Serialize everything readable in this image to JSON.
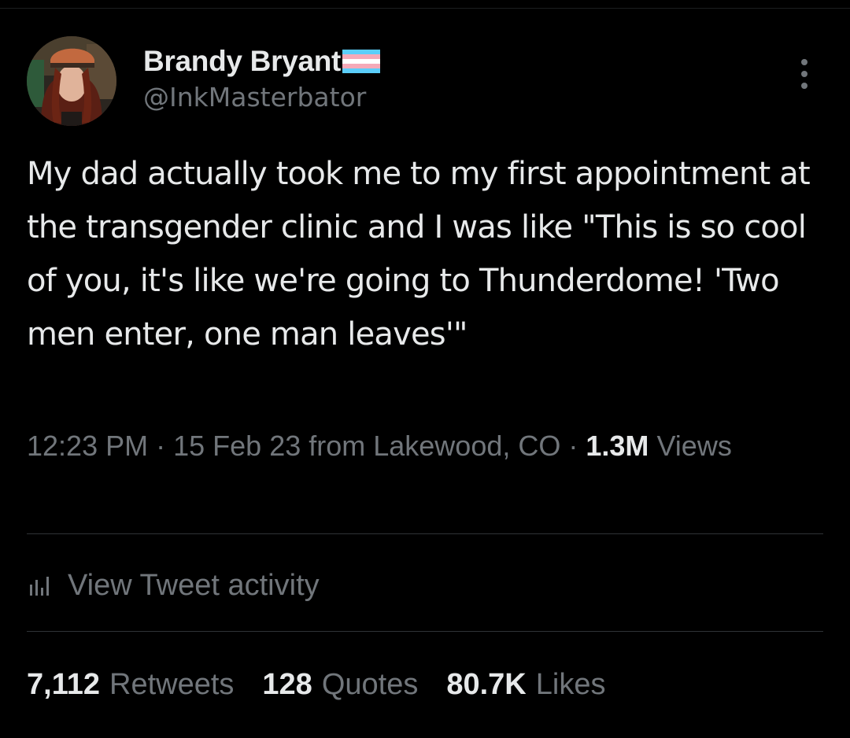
{
  "tweet": {
    "author": {
      "display_name": "Brandy Bryant",
      "handle": "@InkMasterbator",
      "avatar_icon": "profile-photo",
      "badge_icon": "transgender-flag-icon"
    },
    "menu_icon": "more-options-icon",
    "text": "My dad actually took me to my first appointment at the transgender clinic and I was like \"This is so cool of you, it's like we're going to Thunderdome! 'Two men enter, one man leaves'\"",
    "meta": {
      "time": "12:23 PM",
      "separator": "·",
      "date": "15 Feb 23 from Lakewood, CO",
      "views_count": "1.3M",
      "views_label": "Views"
    },
    "activity": {
      "icon": "bar-chart-icon",
      "label": "View Tweet activity"
    },
    "stats": [
      {
        "count": "7,112",
        "label": "Retweets"
      },
      {
        "count": "128",
        "label": "Quotes"
      },
      {
        "count": "80.7K",
        "label": "Likes"
      }
    ]
  },
  "colors": {
    "background": "#000000",
    "primary_text": "#e7e9ea",
    "secondary_text": "#71767b",
    "divider": "#2f3336",
    "flag_blue": "#5bcefa",
    "flag_pink": "#f5a9b8",
    "flag_white": "#ffffff"
  }
}
